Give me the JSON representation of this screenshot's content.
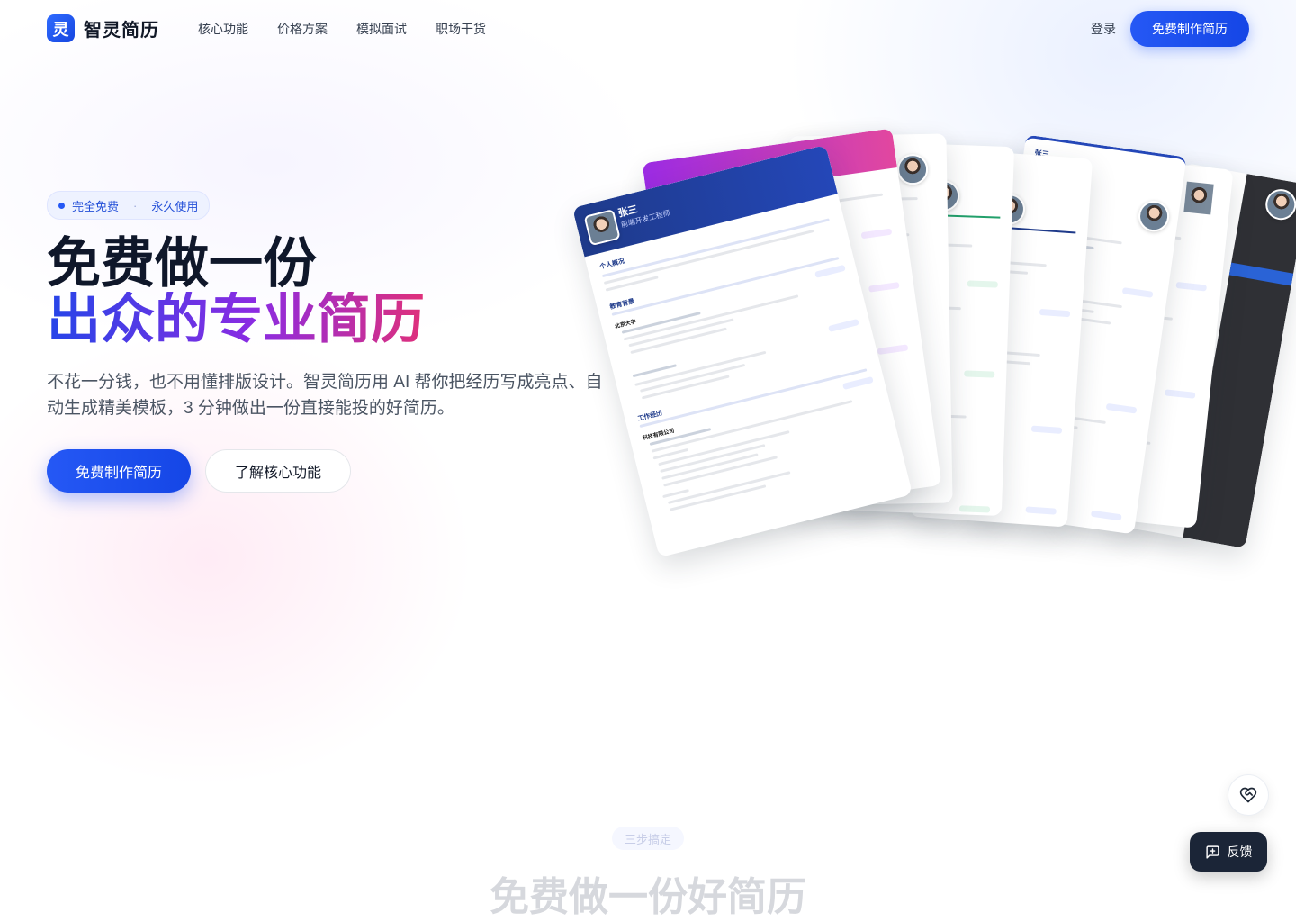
{
  "brand": {
    "logo_glyph": "灵",
    "name": "智灵简历",
    "accent": "#2558f5"
  },
  "nav": {
    "links": [
      "核心功能",
      "价格方案",
      "模拟面试",
      "职场干货"
    ],
    "login": "登录",
    "cta": "免费制作简历"
  },
  "hero": {
    "badge_left": "完全免费",
    "badge_sep": "·",
    "badge_right": "永久使用",
    "title_line1": "免费做一份",
    "title_line2": "出众的专业简历",
    "subtitle": "不花一分钱，也不用懂排版设计。智灵简历用 AI 帮你把经历写成亮点、自动生成精美模板，3 分钟做出一份直接能投的好简历。",
    "cta_primary": "免费制作简历",
    "cta_secondary": "了解核心功能"
  },
  "resume_preview": {
    "name": "张三",
    "role": "前端开发工程师",
    "sections": [
      "个人概况",
      "教育背景",
      "工作经历"
    ],
    "school": "北京大学",
    "company": "科技有限公司"
  },
  "section": {
    "tag": "三步搞定",
    "title": "免费做一份好简历"
  },
  "floating": {
    "feedback": "反馈",
    "heart_icon": "heart-handshake-icon",
    "feedback_icon": "message-square-plus-icon"
  }
}
